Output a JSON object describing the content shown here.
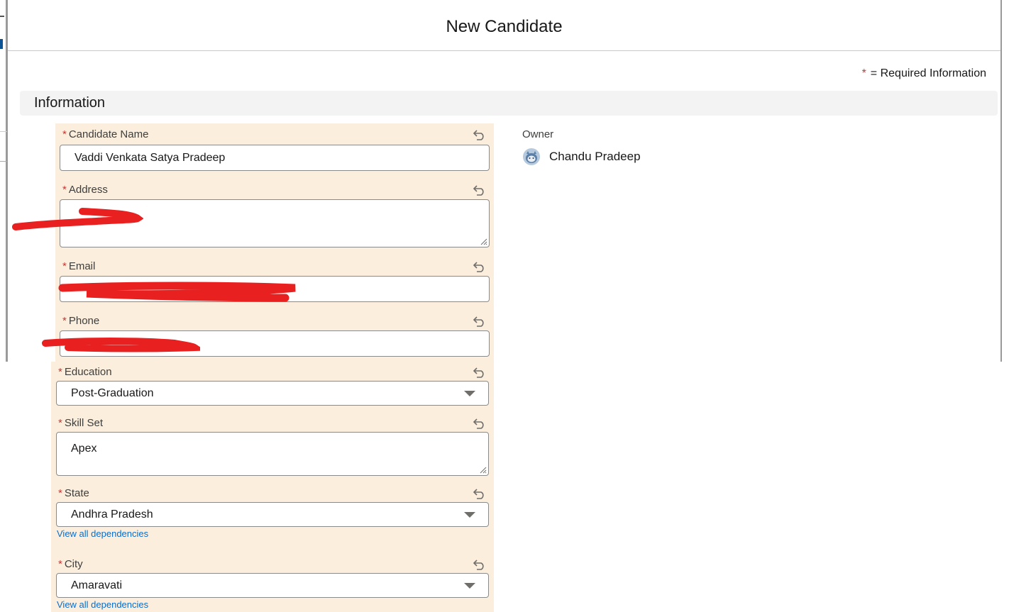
{
  "modal": {
    "title": "New Candidate"
  },
  "required_note": {
    "star": "*",
    "text": "= Required Information"
  },
  "section": {
    "title": "Information"
  },
  "fields": {
    "candidate_name": {
      "label": "Candidate Name",
      "value": "Vaddi Venkata Satya Pradeep"
    },
    "address": {
      "label": "Address",
      "value": ""
    },
    "email": {
      "label": "Email",
      "value": ""
    },
    "phone": {
      "label": "Phone",
      "value": ""
    },
    "education": {
      "label": "Education",
      "value": "Post-Graduation"
    },
    "skill_set": {
      "label": "Skill Set",
      "value": "Apex"
    },
    "state": {
      "label": "State",
      "value": "Andhra Pradesh",
      "link": "View all dependencies"
    },
    "city": {
      "label": "City",
      "value": "Amaravati",
      "link": "View all dependencies"
    }
  },
  "owner": {
    "label": "Owner",
    "name": "Chandu Pradeep"
  },
  "required_star": "*",
  "colors": {
    "panel": "#fbeedd",
    "required": "#c23934",
    "link": "#0b6dc9",
    "redaction": "#e8201f"
  }
}
